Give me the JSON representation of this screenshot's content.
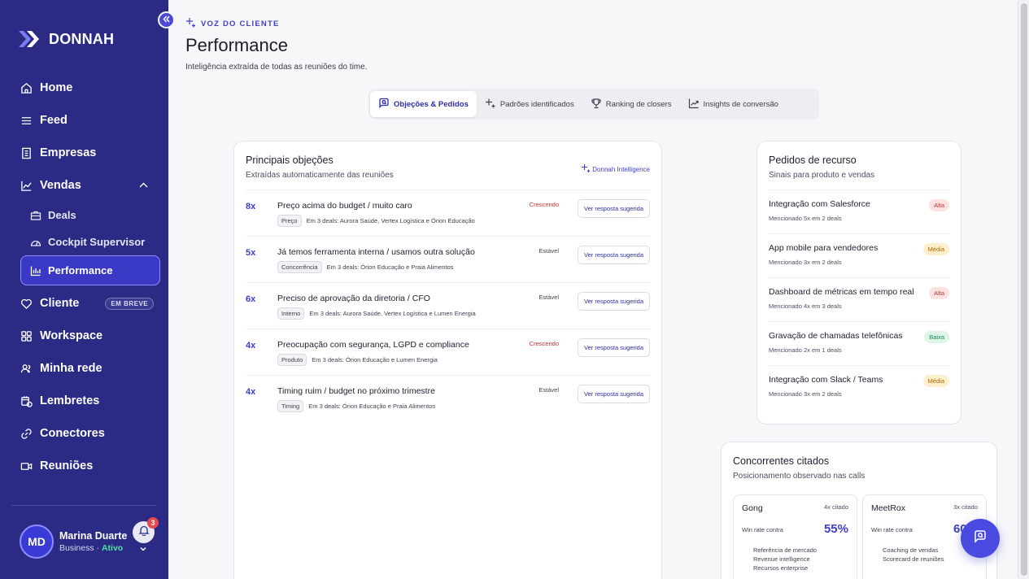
{
  "app": {
    "brand": "DONNAH"
  },
  "sidebar": {
    "items": [
      {
        "label": "Home",
        "icon": "home-icon"
      },
      {
        "label": "Feed",
        "icon": "list-icon"
      },
      {
        "label": "Empresas",
        "icon": "building-icon"
      },
      {
        "label": "Vendas",
        "icon": "chart-line-icon"
      }
    ],
    "sub_items": [
      {
        "label": "Deals",
        "icon": "briefcase-icon"
      },
      {
        "label": "Cockpit Supervisor",
        "icon": "gauge-icon"
      },
      {
        "label": "Performance",
        "icon": "bar-chart-icon",
        "active": true
      }
    ],
    "items_after": [
      {
        "label": "Cliente",
        "icon": "heart-icon",
        "badge": "EM BREVE"
      },
      {
        "label": "Workspace",
        "icon": "grid-icon"
      },
      {
        "label": "Minha rede",
        "icon": "users-icon"
      },
      {
        "label": "Lembretes",
        "icon": "calendar-clock-icon"
      },
      {
        "label": "Conectores",
        "icon": "link-icon"
      },
      {
        "label": "Reuniões",
        "icon": "video-icon"
      }
    ],
    "user": {
      "initials": "MD",
      "name": "Marina Duarte",
      "plan": "Business",
      "separator": "·",
      "status": "Ativo",
      "notifications": "3"
    }
  },
  "header": {
    "eyebrow": "VOZ DO CLIENTE",
    "title": "Performance",
    "subtitle": "Inteligência extraída de todas as reuniões do time."
  },
  "tabs": [
    {
      "label": "Objeções & Pedidos",
      "icon": "chat-search-icon",
      "active": true
    },
    {
      "label": "Padrões identificados",
      "icon": "sparkles-icon"
    },
    {
      "label": "Ranking de closers",
      "icon": "trophy-icon"
    },
    {
      "label": "Insights de conversão",
      "icon": "trend-up-icon"
    }
  ],
  "objections": {
    "title": "Principais objeções",
    "subtitle": "Extraídas automaticamente das reuniões",
    "intel_tag": "Donnah Intelligence",
    "button_label": "Ver resposta sugerida",
    "rows": [
      {
        "count": "8x",
        "title": "Preço acima do budget / muito caro",
        "tag": "Preço",
        "deals": "Em 3 deals: Aurora Saúde, Vertex Logística e Órion Educação",
        "trend": "Crescendo",
        "trend_up": true
      },
      {
        "count": "5x",
        "title": "Já temos ferramenta interna / usamos outra solução",
        "tag": "Concorrência",
        "deals": "Em 3 deals: Órion Educação e Praia Alimentos",
        "trend": "Estável",
        "trend_up": false
      },
      {
        "count": "6x",
        "title": "Preciso de aprovação da diretoria / CFO",
        "tag": "Interno",
        "deals": "Em 3 deals: Aurora Saúde, Vertex Logística e Lumen Energia",
        "trend": "Estável",
        "trend_up": false
      },
      {
        "count": "4x",
        "title": "Preocupação com segurança, LGPD e compliance",
        "tag": "Produto",
        "deals": "Em 3 deals: Órion Educação e Lumen Energia",
        "trend": "Crescendo",
        "trend_up": true
      },
      {
        "count": "4x",
        "title": "Timing ruim / budget no próximo trimestre",
        "tag": "Timing",
        "deals": "Em 3 deals: Órion Educação e Praia Alimentos",
        "trend": "Estável",
        "trend_up": false
      }
    ]
  },
  "requests": {
    "title": "Pedidos de recurso",
    "subtitle": "Sinais para produto e vendas",
    "rows": [
      {
        "title": "Integração com Salesforce",
        "meta": "Mencionado 5x em 2 deals",
        "priority": "Alta",
        "level": "alta"
      },
      {
        "title": "App mobile para vendedores",
        "meta": "Mencionado 3x em 2 deals",
        "priority": "Média",
        "level": "media"
      },
      {
        "title": "Dashboard de métricas em tempo real",
        "meta": "Mencionado 4x em 3 deals",
        "priority": "Alta",
        "level": "alta"
      },
      {
        "title": "Gravação de chamadas telefônicas",
        "meta": "Mencionado 2x em 1 deals",
        "priority": "Baixa",
        "level": "baixa"
      },
      {
        "title": "Integração com Slack / Teams",
        "meta": "Mencionado 3x em 2 deals",
        "priority": "Média",
        "level": "media"
      }
    ]
  },
  "competitors": {
    "title": "Concorrentes citados",
    "subtitle": "Posicionamento observado nas calls",
    "items": [
      {
        "name": "Gong",
        "cited": "4x citado",
        "wr_label": "Win rate contra",
        "wr": "55%",
        "points": [
          "Referência de mercado",
          "Revenue intelligence",
          "Recursos enterprise"
        ]
      },
      {
        "name": "MeetRox",
        "cited": "3x citado",
        "wr_label": "Win rate contra",
        "wr": "60%",
        "points": [
          "Coaching de vendas",
          "Scorecard de reuniões"
        ]
      }
    ]
  },
  "colors": {
    "sidebar": "#2b2b85",
    "accent": "#3f3fc8",
    "danger": "#d22b2b"
  }
}
